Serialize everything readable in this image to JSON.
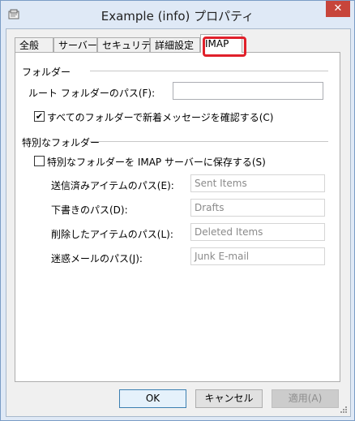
{
  "window": {
    "title": "Example (info) プロパティ",
    "close_symbol": "✕"
  },
  "tabs": [
    "全般",
    "サーバー",
    "セキュリティ",
    "詳細設定",
    "IMAP"
  ],
  "active_tab": "IMAP",
  "folders_group": {
    "title": "フォルダー",
    "root_path_label": "ルート フォルダーのパス(F):",
    "root_path_value": "",
    "check_new_label": "すべてのフォルダーで新着メッセージを確認する(C)",
    "check_new_checked": true
  },
  "special_group": {
    "title": "特別なフォルダー",
    "store_on_server_label": "特別なフォルダーを IMAP サーバーに保存する(S)",
    "store_on_server_checked": false,
    "sent_label": "送信済みアイテムのパス(E):",
    "sent_value": "Sent Items",
    "drafts_label": "下書きのパス(D):",
    "drafts_value": "Drafts",
    "deleted_label": "削除したアイテムのパス(L):",
    "deleted_value": "Deleted Items",
    "junk_label": "迷惑メールのパス(J):",
    "junk_value": "Junk E-mail"
  },
  "buttons": {
    "ok": "OK",
    "cancel": "キャンセル",
    "apply": "適用(A)"
  },
  "colors": {
    "highlight": "#e0202a",
    "title_bar": "#dfe9f6",
    "close": "#c7453b"
  }
}
